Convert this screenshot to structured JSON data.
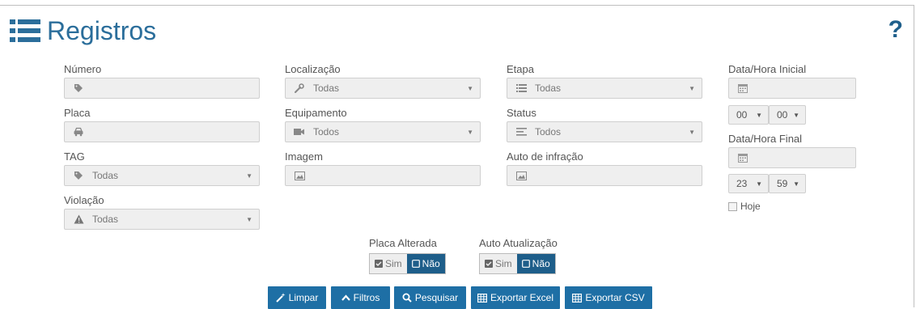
{
  "header": {
    "title": "Registros",
    "help": "?"
  },
  "filters": {
    "numero": {
      "label": "Número"
    },
    "placa": {
      "label": "Placa"
    },
    "tag": {
      "label": "TAG",
      "value": "Todas"
    },
    "violacao": {
      "label": "Violação",
      "value": "Todas"
    },
    "localizacao": {
      "label": "Localização",
      "value": "Todas"
    },
    "equipamento": {
      "label": "Equipamento",
      "value": "Todos"
    },
    "imagem": {
      "label": "Imagem"
    },
    "etapa": {
      "label": "Etapa",
      "value": "Todas"
    },
    "status": {
      "label": "Status",
      "value": "Todos"
    },
    "auto_infracao": {
      "label": "Auto de infração"
    },
    "data_inicial": {
      "label": "Data/Hora Inicial",
      "hour": "00",
      "minute": "00"
    },
    "data_final": {
      "label": "Data/Hora Final",
      "hour": "23",
      "minute": "59"
    },
    "hoje": {
      "label": "Hoje"
    }
  },
  "toggles": {
    "placa_alterada": {
      "label": "Placa Alterada",
      "sim": "Sim",
      "nao": "Não",
      "selected": "Não"
    },
    "auto_atualizacao": {
      "label": "Auto Atualização",
      "sim": "Sim",
      "nao": "Não",
      "selected": "Não"
    }
  },
  "actions": {
    "limpar": "Limpar",
    "filtros": "Filtros",
    "pesquisar": "Pesquisar",
    "exportar_excel": "Exportar Excel",
    "exportar_csv": "Exportar CSV"
  },
  "colors": {
    "brand": "#2b6e9b",
    "button": "#1e6fa5",
    "toggle_active": "#1e5e8a"
  },
  "icons": [
    "list-icon",
    "tag-icon",
    "car-icon",
    "wrench-icon",
    "video-camera-icon",
    "image-icon",
    "list-lines-icon",
    "align-left-icon",
    "calendar-icon",
    "warning-icon",
    "magic-wand-icon",
    "chevron-up-icon",
    "search-icon",
    "table-icon",
    "help-icon"
  ]
}
